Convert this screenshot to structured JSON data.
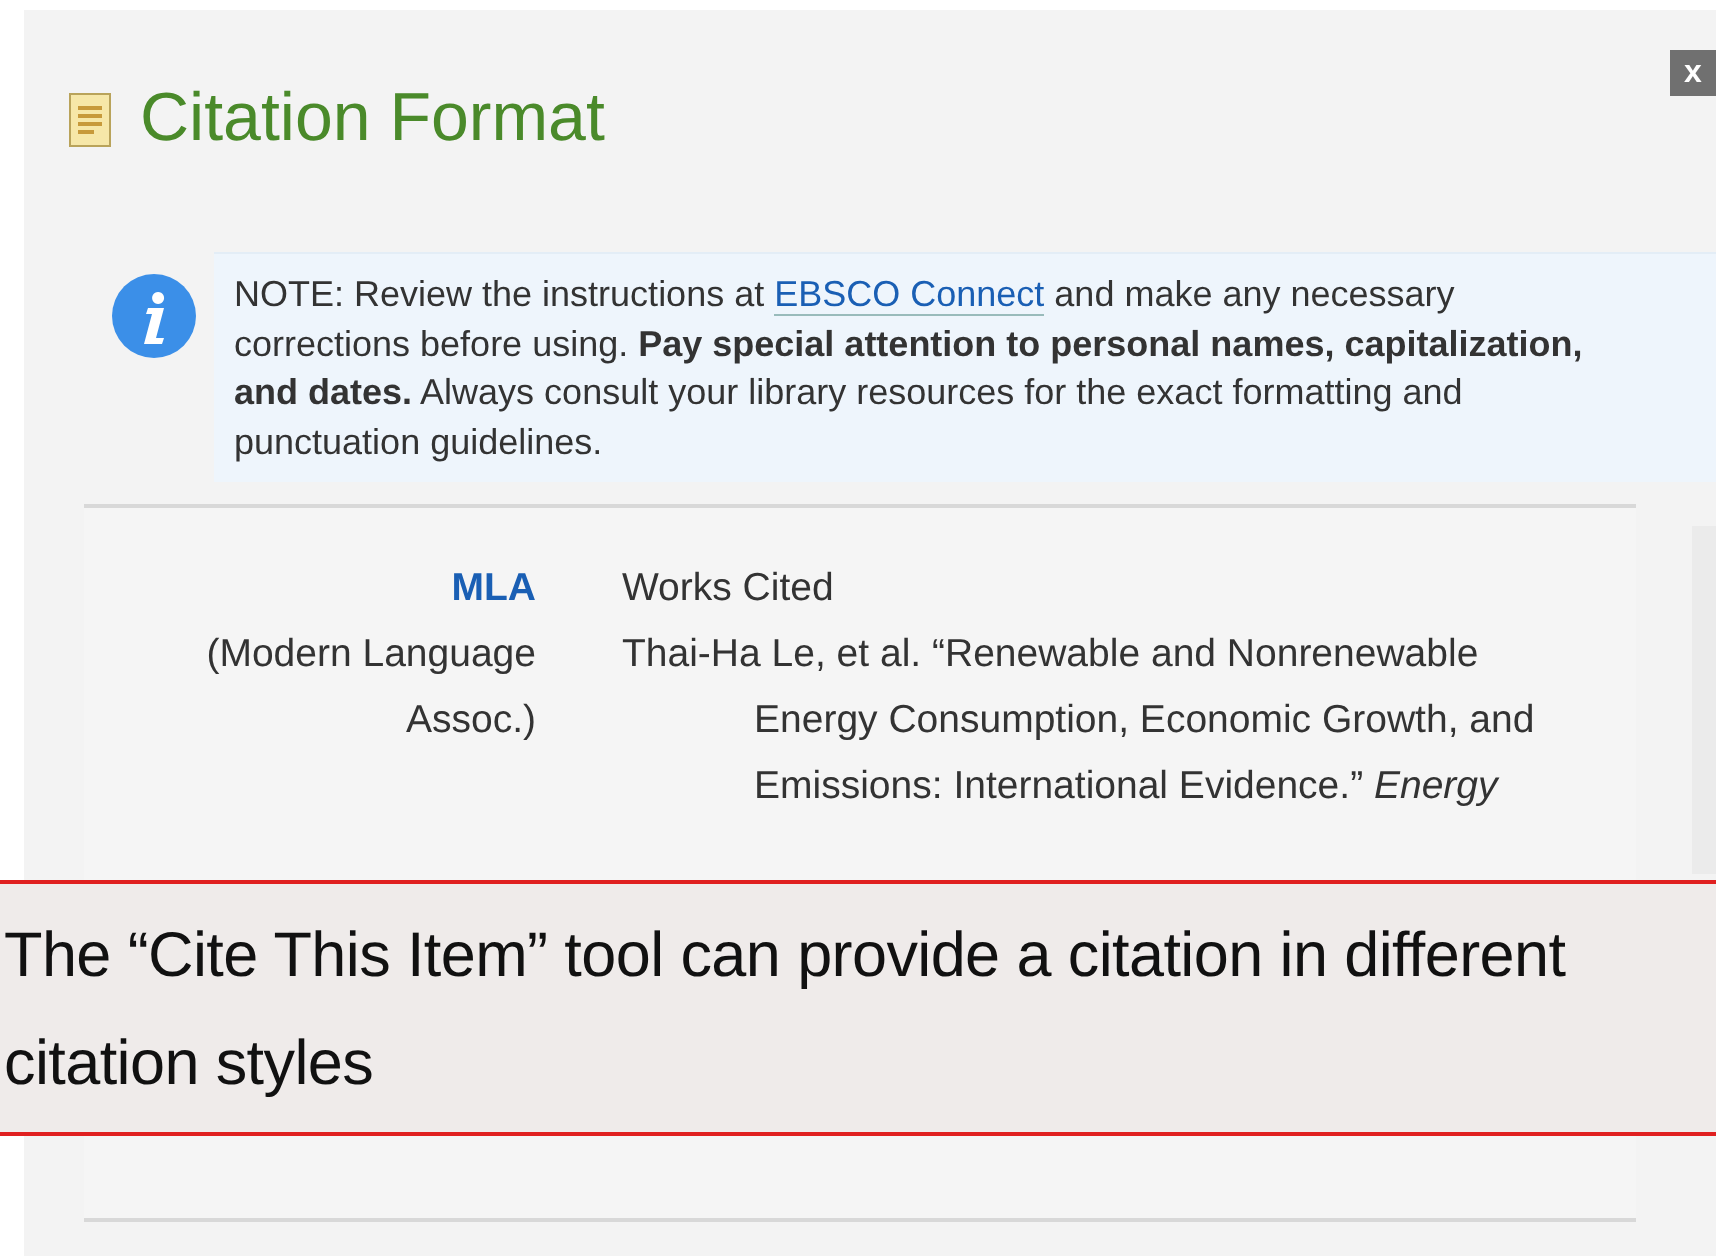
{
  "dialog": {
    "title": "Citation Format",
    "close": "x"
  },
  "note": {
    "before": "NOTE: Review the instructions at ",
    "link": "EBSCO Connect",
    "after": " and make any necessary corrections before using. **Pay special attention to personal names, capitalization, and dates.** Always consult your library resources for the exact formatting and punctuation guidelines."
  },
  "citations": [
    {
      "style": "MLA",
      "style_full": "(Modern Language Assoc.)",
      "heading": "Works Cited",
      "entry": "Thai-Ha Le, et al. “Renewable and Nonrenewable Energy Consumption, Economic Growth, and Emissions: International Evidence.” *Energy*"
    }
  ],
  "callout": {
    "text": "The “Cite This Item” tool can provide a citation in different citation styles"
  }
}
